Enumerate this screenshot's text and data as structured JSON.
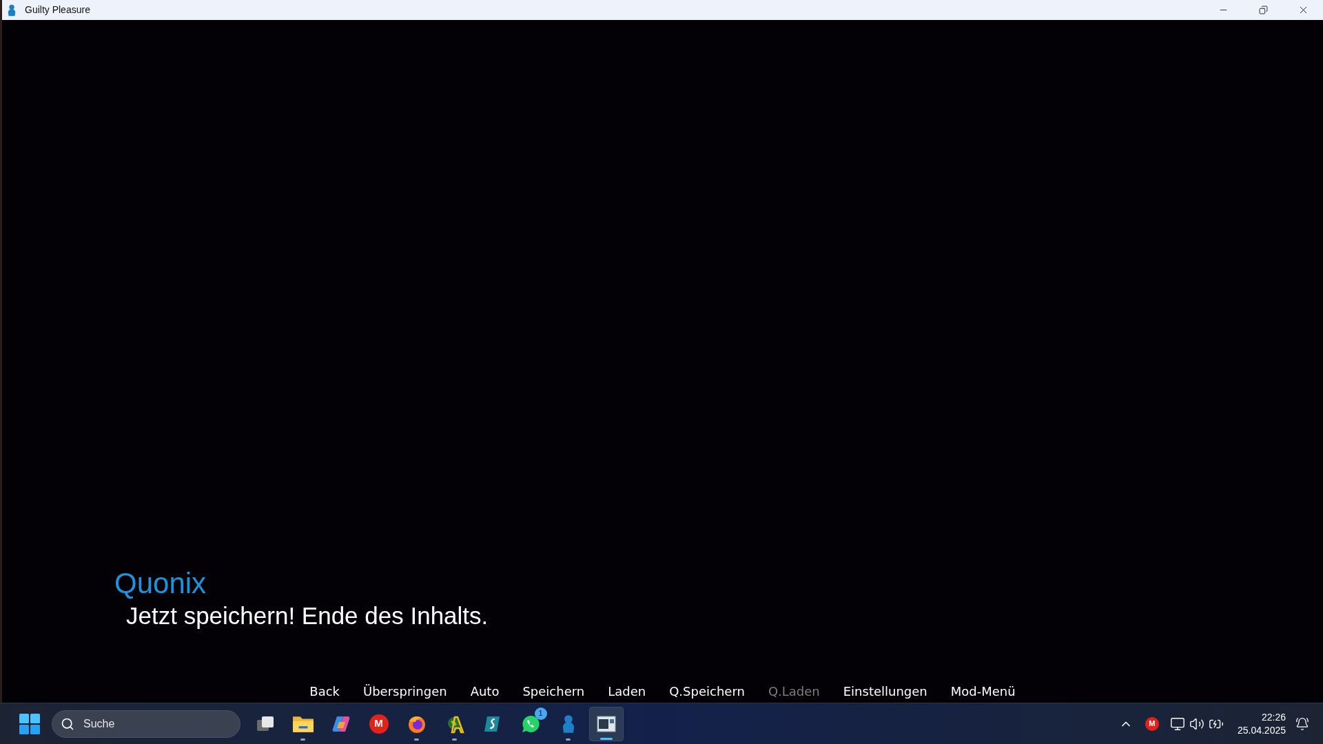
{
  "window": {
    "title": "Guilty Pleasure"
  },
  "dialogue": {
    "speaker": "Quonix",
    "text": "Jetzt speichern! Ende des Inhalts."
  },
  "quick_menu": [
    {
      "label": "Back",
      "disabled": false
    },
    {
      "label": "Überspringen",
      "disabled": false
    },
    {
      "label": "Auto",
      "disabled": false
    },
    {
      "label": "Speichern",
      "disabled": false
    },
    {
      "label": "Laden",
      "disabled": false
    },
    {
      "label": "Q.Speichern",
      "disabled": false
    },
    {
      "label": "Q.Laden",
      "disabled": true
    },
    {
      "label": "Einstellungen",
      "disabled": false
    },
    {
      "label": "Mod-Menü",
      "disabled": false
    }
  ],
  "taskbar": {
    "search": {
      "placeholder": "Suche"
    },
    "apps": [
      {
        "kind": "taskview",
        "running": false,
        "selected": false
      },
      {
        "kind": "folder",
        "running": true,
        "selected": false
      },
      {
        "kind": "copilot",
        "running": false,
        "selected": false
      },
      {
        "kind": "mega",
        "glyph": "M",
        "running": false,
        "selected": false
      },
      {
        "kind": "firefox",
        "running": true,
        "selected": false
      },
      {
        "kind": "globe",
        "running": true,
        "selected": false
      },
      {
        "kind": "surf",
        "running": false,
        "selected": false
      },
      {
        "kind": "chat",
        "badge": "1",
        "running": false,
        "selected": false
      },
      {
        "kind": "figure",
        "running": true,
        "selected": false
      },
      {
        "kind": "window",
        "running": true,
        "selected": true
      }
    ],
    "tray": {
      "mega_glyph": "M",
      "time": "22:26",
      "date": "25.04.2025"
    }
  }
}
